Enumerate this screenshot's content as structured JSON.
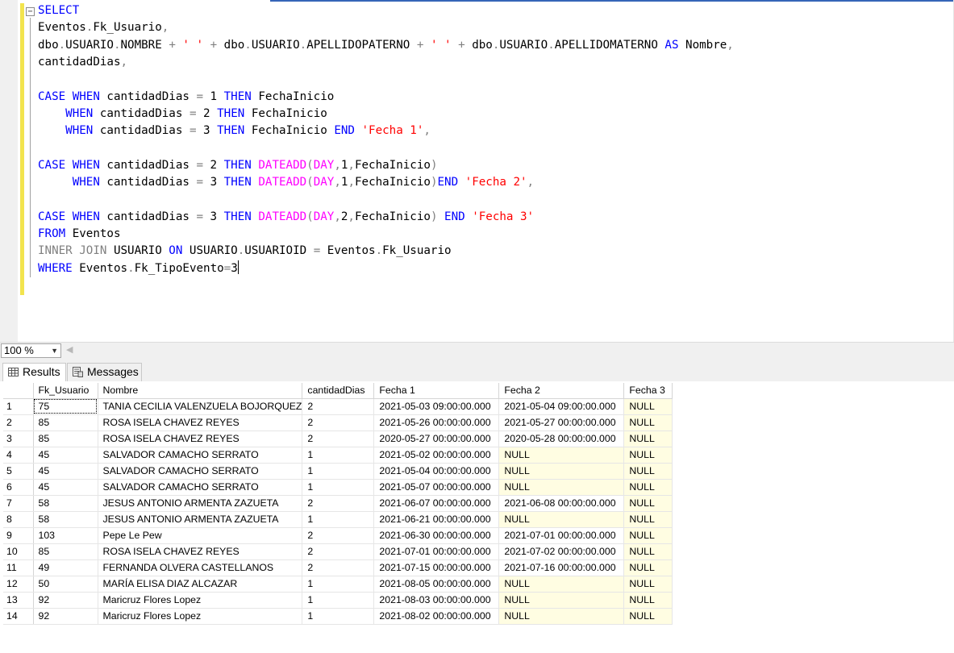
{
  "editor": {
    "collapse_glyph": "−",
    "lines": [
      [
        [
          "kw",
          "SELECT"
        ]
      ],
      [
        [
          "t",
          "Eventos"
        ],
        [
          "gr",
          "."
        ],
        [
          "t",
          "Fk_Usuario"
        ],
        [
          "gr",
          ","
        ]
      ],
      [
        [
          "t",
          "dbo"
        ],
        [
          "gr",
          "."
        ],
        [
          "t",
          "USUARIO"
        ],
        [
          "gr",
          "."
        ],
        [
          "t",
          "NOMBRE "
        ],
        [
          "gr",
          "+"
        ],
        [
          "t",
          " "
        ],
        [
          "st",
          "' '"
        ],
        [
          "t",
          " "
        ],
        [
          "gr",
          "+"
        ],
        [
          "t",
          " dbo"
        ],
        [
          "gr",
          "."
        ],
        [
          "t",
          "USUARIO"
        ],
        [
          "gr",
          "."
        ],
        [
          "t",
          "APELLIDOPATERNO "
        ],
        [
          "gr",
          "+"
        ],
        [
          "t",
          " "
        ],
        [
          "st",
          "' '"
        ],
        [
          "t",
          " "
        ],
        [
          "gr",
          "+"
        ],
        [
          "t",
          " dbo"
        ],
        [
          "gr",
          "."
        ],
        [
          "t",
          "USUARIO"
        ],
        [
          "gr",
          "."
        ],
        [
          "t",
          "APELLIDOMATERNO "
        ],
        [
          "kw",
          "AS"
        ],
        [
          "t",
          " Nombre"
        ],
        [
          "gr",
          ","
        ]
      ],
      [
        [
          "t",
          "cantidadDias"
        ],
        [
          "gr",
          ","
        ]
      ],
      [],
      [
        [
          "kw",
          "CASE WHEN"
        ],
        [
          "t",
          " cantidadDias "
        ],
        [
          "gr",
          "="
        ],
        [
          "t",
          " 1 "
        ],
        [
          "kw",
          "THEN"
        ],
        [
          "t",
          " FechaInicio"
        ]
      ],
      [
        [
          "t",
          "    "
        ],
        [
          "kw",
          "WHEN"
        ],
        [
          "t",
          " cantidadDias "
        ],
        [
          "gr",
          "="
        ],
        [
          "t",
          " 2 "
        ],
        [
          "kw",
          "THEN"
        ],
        [
          "t",
          " FechaInicio"
        ]
      ],
      [
        [
          "t",
          "    "
        ],
        [
          "kw",
          "WHEN"
        ],
        [
          "t",
          " cantidadDias "
        ],
        [
          "gr",
          "="
        ],
        [
          "t",
          " 3 "
        ],
        [
          "kw",
          "THEN"
        ],
        [
          "t",
          " FechaInicio "
        ],
        [
          "kw",
          "END"
        ],
        [
          "t",
          " "
        ],
        [
          "st",
          "'Fecha 1'"
        ],
        [
          "gr",
          ","
        ]
      ],
      [],
      [
        [
          "kw",
          "CASE WHEN"
        ],
        [
          "t",
          " cantidadDias "
        ],
        [
          "gr",
          "="
        ],
        [
          "t",
          " 2 "
        ],
        [
          "kw",
          "THEN"
        ],
        [
          "t",
          " "
        ],
        [
          "fn",
          "DATEADD"
        ],
        [
          "gr",
          "("
        ],
        [
          "fn",
          "DAY"
        ],
        [
          "gr",
          ","
        ],
        [
          "t",
          "1"
        ],
        [
          "gr",
          ","
        ],
        [
          "t",
          "FechaInicio"
        ],
        [
          "gr",
          ")"
        ]
      ],
      [
        [
          "t",
          "     "
        ],
        [
          "kw",
          "WHEN"
        ],
        [
          "t",
          " cantidadDias "
        ],
        [
          "gr",
          "="
        ],
        [
          "t",
          " 3 "
        ],
        [
          "kw",
          "THEN"
        ],
        [
          "t",
          " "
        ],
        [
          "fn",
          "DATEADD"
        ],
        [
          "gr",
          "("
        ],
        [
          "fn",
          "DAY"
        ],
        [
          "gr",
          ","
        ],
        [
          "t",
          "1"
        ],
        [
          "gr",
          ","
        ],
        [
          "t",
          "FechaInicio"
        ],
        [
          "gr",
          ")"
        ],
        [
          "kw",
          "END"
        ],
        [
          "t",
          " "
        ],
        [
          "st",
          "'Fecha 2'"
        ],
        [
          "gr",
          ","
        ]
      ],
      [],
      [
        [
          "kw",
          "CASE WHEN"
        ],
        [
          "t",
          " cantidadDias "
        ],
        [
          "gr",
          "="
        ],
        [
          "t",
          " 3 "
        ],
        [
          "kw",
          "THEN"
        ],
        [
          "t",
          " "
        ],
        [
          "fn",
          "DATEADD"
        ],
        [
          "gr",
          "("
        ],
        [
          "fn",
          "DAY"
        ],
        [
          "gr",
          ","
        ],
        [
          "t",
          "2"
        ],
        [
          "gr",
          ","
        ],
        [
          "t",
          "FechaInicio"
        ],
        [
          "gr",
          ")"
        ],
        [
          "t",
          " "
        ],
        [
          "kw",
          "END"
        ],
        [
          "t",
          " "
        ],
        [
          "st",
          "'Fecha 3'"
        ]
      ],
      [
        [
          "kw",
          "FROM"
        ],
        [
          "t",
          " Eventos"
        ]
      ],
      [
        [
          "gr",
          "INNER JOIN"
        ],
        [
          "t",
          " USUARIO "
        ],
        [
          "kw",
          "ON"
        ],
        [
          "t",
          " USUARIO"
        ],
        [
          "gr",
          "."
        ],
        [
          "t",
          "USUARIOID "
        ],
        [
          "gr",
          "="
        ],
        [
          "t",
          " Eventos"
        ],
        [
          "gr",
          "."
        ],
        [
          "t",
          "Fk_Usuario"
        ]
      ],
      [
        [
          "kw",
          "WHERE"
        ],
        [
          "t",
          " Eventos"
        ],
        [
          "gr",
          "."
        ],
        [
          "t",
          "Fk_TipoEvento"
        ],
        [
          "gr",
          "="
        ],
        [
          "t",
          "3"
        ],
        [
          "caret",
          ""
        ]
      ]
    ]
  },
  "zoom": {
    "value": "100 %"
  },
  "tabs": {
    "results_label": "Results",
    "messages_label": "Messages"
  },
  "grid": {
    "columns": [
      "Fk_Usuario",
      "Nombre",
      "cantidadDias",
      "Fecha 1",
      "Fecha 2",
      "Fecha 3"
    ],
    "rows": [
      [
        "1",
        "75",
        "TANIA CECILIA VALENZUELA BOJORQUEZ",
        "2",
        "2021-05-03 09:00:00.000",
        "2021-05-04 09:00:00.000",
        "NULL"
      ],
      [
        "2",
        "85",
        "ROSA ISELA CHAVEZ REYES",
        "2",
        "2021-05-26 00:00:00.000",
        "2021-05-27 00:00:00.000",
        "NULL"
      ],
      [
        "3",
        "85",
        "ROSA ISELA CHAVEZ REYES",
        "2",
        "2020-05-27 00:00:00.000",
        "2020-05-28 00:00:00.000",
        "NULL"
      ],
      [
        "4",
        "45",
        "SALVADOR CAMACHO SERRATO",
        "1",
        "2021-05-02 00:00:00.000",
        "NULL",
        "NULL"
      ],
      [
        "5",
        "45",
        "SALVADOR CAMACHO SERRATO",
        "1",
        "2021-05-04 00:00:00.000",
        "NULL",
        "NULL"
      ],
      [
        "6",
        "45",
        "SALVADOR CAMACHO SERRATO",
        "1",
        "2021-05-07 00:00:00.000",
        "NULL",
        "NULL"
      ],
      [
        "7",
        "58",
        "JESUS ANTONIO ARMENTA ZAZUETA",
        "2",
        "2021-06-07 00:00:00.000",
        "2021-06-08 00:00:00.000",
        "NULL"
      ],
      [
        "8",
        "58",
        "JESUS ANTONIO ARMENTA ZAZUETA",
        "1",
        "2021-06-21 00:00:00.000",
        "NULL",
        "NULL"
      ],
      [
        "9",
        "103",
        "Pepe Le Pew",
        "2",
        "2021-06-30 00:00:00.000",
        "2021-07-01 00:00:00.000",
        "NULL"
      ],
      [
        "10",
        "85",
        "ROSA ISELA CHAVEZ REYES",
        "2",
        "2021-07-01 00:00:00.000",
        "2021-07-02 00:00:00.000",
        "NULL"
      ],
      [
        "11",
        "49",
        "FERNANDA OLVERA CASTELLANOS",
        "2",
        "2021-07-15 00:00:00.000",
        "2021-07-16 00:00:00.000",
        "NULL"
      ],
      [
        "12",
        "50",
        "MARÍA ELISA DIAZ ALCAZAR",
        "1",
        "2021-08-05 00:00:00.000",
        "NULL",
        "NULL"
      ],
      [
        "13",
        "92",
        "Maricruz Flores Lopez",
        "1",
        "2021-08-03 00:00:00.000",
        "NULL",
        "NULL"
      ],
      [
        "14",
        "92",
        "Maricruz Flores Lopez",
        "1",
        "2021-08-02 00:00:00.000",
        "NULL",
        "NULL"
      ]
    ]
  },
  "colors": {
    "keyword": "#0000ff",
    "operator": "#808080",
    "function": "#ff00ff",
    "string": "#ff0000",
    "null_cell": "#fffde2",
    "change_bar": "#f2e44e"
  },
  "icons": {
    "results_tab": "grid-icon",
    "messages_tab": "messages-icon",
    "zoom_dropdown": "dropdown-arrow-icon",
    "scroll_left": "scroll-left-arrow-icon"
  }
}
